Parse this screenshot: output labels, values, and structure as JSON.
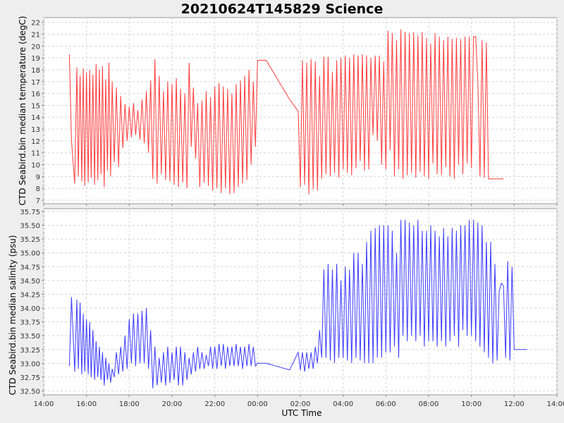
{
  "title": "20210624T145829 Science",
  "colors": {
    "temperature": "#ff3b3b",
    "salinity": "#3b3bff",
    "grid": "#d4d4d4",
    "background": "#ffffff",
    "page": "#eeeeee"
  },
  "chart_data": {
    "type": "line",
    "title": "20210624T145829 Science",
    "xlabel": "UTC Time",
    "x_ticks": [
      "14:00",
      "16:00",
      "18:00",
      "20:00",
      "22:00",
      "00:00",
      "02:00",
      "04:00",
      "06:00",
      "08:00",
      "10:00",
      "12:00",
      "14:00"
    ],
    "xlim": [
      14,
      38
    ],
    "grid": true,
    "panels": [
      {
        "name": "temperature",
        "ylabel": "CTD Seabird.bin median temperature (degC)",
        "ylim": [
          6.7,
          22.4
        ],
        "y_ticks": [
          7,
          8,
          9,
          10,
          11,
          12,
          13,
          14,
          15,
          16,
          17,
          18,
          19,
          20,
          21,
          22
        ],
        "series": [
          {
            "x": [
              15.2,
              15.3,
              15.45,
              15.55,
              15.62,
              15.7,
              15.78,
              15.85,
              15.92,
              16.0,
              16.08,
              16.15,
              16.22,
              16.3,
              16.38,
              16.45,
              16.53,
              16.6,
              16.68,
              16.75,
              16.83,
              16.9,
              16.98,
              17.05,
              17.13,
              17.2,
              17.3,
              17.4,
              17.5,
              17.6,
              17.7,
              17.8,
              17.9,
              18.0,
              18.1,
              18.2,
              18.3,
              18.4,
              18.5,
              18.6,
              18.7,
              18.8,
              18.9,
              19.0,
              19.1,
              19.2,
              19.3,
              19.4,
              19.5,
              19.6,
              19.7,
              19.8,
              19.9,
              20.0,
              20.1,
              20.2,
              20.3,
              20.4,
              20.5,
              20.6,
              20.7,
              20.8,
              20.9,
              21.0,
              21.1,
              21.2,
              21.3,
              21.4,
              21.5,
              21.6,
              21.7,
              21.8,
              21.9,
              22.0,
              22.1,
              22.2,
              22.3,
              22.4,
              22.5,
              22.6,
              22.7,
              22.8,
              22.9,
              23.0,
              23.1,
              23.2,
              23.3,
              23.4,
              23.5,
              23.6,
              23.7,
              23.8,
              23.9,
              24.0,
              24.4,
              25.5,
              25.9,
              26.0,
              26.1,
              26.2,
              26.3,
              26.4,
              26.5,
              26.6,
              26.7,
              26.8,
              26.9,
              27.0,
              27.1,
              27.2,
              27.3,
              27.4,
              27.5,
              27.6,
              27.7,
              27.8,
              27.9,
              28.0,
              28.1,
              28.2,
              28.3,
              28.4,
              28.5,
              28.6,
              28.7,
              28.8,
              28.9,
              29.0,
              29.1,
              29.2,
              29.3,
              29.4,
              29.5,
              29.6,
              29.7,
              29.8,
              29.9,
              30.0,
              30.1,
              30.2,
              30.3,
              30.4,
              30.5,
              30.6,
              30.7,
              30.8,
              30.9,
              31.0,
              31.1,
              31.2,
              31.3,
              31.4,
              31.5,
              31.6,
              31.7,
              31.8,
              31.9,
              32.0,
              32.1,
              32.2,
              32.3,
              32.4,
              32.5,
              32.6,
              32.7,
              32.8,
              32.9,
              33.0,
              33.1,
              33.2,
              33.3,
              33.4,
              33.5,
              33.6,
              33.7,
              33.8,
              33.9,
              34.0,
              34.1,
              34.2,
              34.3,
              34.4,
              34.5,
              34.6,
              34.7,
              34.8,
              34.9,
              35.0,
              35.1,
              35.2,
              35.3,
              35.4,
              35.5,
              35.6,
              35.7,
              35.8,
              35.9,
              36.0,
              36.1,
              36.2,
              36.3,
              36.4,
              36.5,
              36.6,
              36.7,
              36.8,
              36.9,
              37.0
            ],
            "y": [
              19.3,
              12.0,
              8.4,
              18.2,
              9.0,
              17.5,
              8.6,
              18.1,
              8.2,
              17.8,
              8.5,
              18.0,
              8.9,
              17.6,
              8.3,
              18.5,
              8.7,
              18.0,
              9.2,
              18.3,
              8.1,
              17.2,
              9.5,
              18.6,
              9.0,
              17.0,
              10.2,
              16.5,
              9.8,
              15.8,
              11.4,
              15.1,
              12.0,
              14.9,
              12.3,
              15.2,
              12.5,
              14.6,
              12.1,
              15.5,
              11.8,
              16.2,
              11.0,
              17.1,
              8.8,
              18.9,
              8.4,
              17.5,
              9.2,
              16.2,
              8.7,
              17.0,
              8.6,
              16.8,
              8.3,
              17.3,
              8.1,
              16.4,
              8.5,
              16.0,
              8.0,
              18.6,
              11.5,
              16.5,
              10.5,
              15.2,
              8.1,
              15.4,
              8.5,
              16.2,
              8.2,
              15.7,
              7.8,
              16.6,
              8.0,
              16.9,
              7.6,
              16.6,
              8.0,
              16.4,
              7.5,
              16.0,
              7.6,
              16.8,
              8.1,
              17.1,
              8.4,
              17.5,
              8.7,
              18.0,
              10.0,
              17.0,
              11.5,
              18.8,
              18.8,
              15.5,
              14.5,
              8.1,
              18.8,
              8.3,
              18.6,
              7.5,
              18.9,
              7.9,
              18.7,
              7.8,
              17.5,
              8.8,
              19.1,
              9.2,
              19.1,
              9.0,
              17.8,
              9.3,
              18.8,
              8.9,
              19.0,
              9.6,
              19.2,
              9.3,
              19.0,
              9.1,
              19.3,
              9.7,
              19.2,
              10.3,
              19.3,
              9.5,
              19.2,
              9.6,
              19.0,
              12.5,
              19.2,
              12.0,
              19.2,
              10.0,
              18.7,
              9.6,
              21.3,
              11.2,
              21.1,
              9.0,
              20.5,
              9.6,
              21.4,
              8.8,
              21.2,
              9.1,
              21.1,
              9.3,
              21.2,
              8.9,
              20.9,
              9.4,
              21.2,
              9.0,
              20.7,
              8.8,
              20.2,
              10.1,
              21.1,
              9.2,
              20.8,
              9.1,
              20.5,
              9.8,
              20.8,
              9.0,
              20.6,
              8.8,
              20.7,
              10.0,
              20.6,
              9.2,
              20.8,
              10.1,
              20.8,
              9.7,
              20.8,
              20.8,
              17.0,
              9.0,
              20.5,
              8.9,
              20.3,
              8.8,
              8.8,
              8.8,
              8.8,
              8.8,
              8.8,
              8.8,
              8.8
            ]
          }
        ]
      },
      {
        "name": "salinity",
        "ylabel": "CTD Seabird.bin median salinity (psu)",
        "ylim": [
          32.43,
          35.8
        ],
        "y_ticks": [
          "32.50",
          "32.75",
          "33.00",
          "33.25",
          "33.50",
          "33.75",
          "34.00",
          "34.25",
          "34.50",
          "34.75",
          "35.00",
          "35.25",
          "35.50",
          "35.75"
        ],
        "series": [
          {
            "x": [
              15.2,
              15.3,
              15.45,
              15.55,
              15.62,
              15.7,
              15.78,
              15.85,
              15.92,
              16.0,
              16.08,
              16.15,
              16.22,
              16.3,
              16.38,
              16.45,
              16.53,
              16.6,
              16.68,
              16.75,
              16.83,
              16.9,
              16.98,
              17.05,
              17.13,
              17.2,
              17.3,
              17.4,
              17.5,
              17.6,
              17.7,
              17.8,
              17.9,
              18.0,
              18.1,
              18.2,
              18.3,
              18.4,
              18.5,
              18.6,
              18.7,
              18.8,
              18.9,
              19.0,
              19.1,
              19.2,
              19.3,
              19.4,
              19.5,
              19.6,
              19.7,
              19.8,
              19.9,
              20.0,
              20.1,
              20.2,
              20.3,
              20.4,
              20.5,
              20.6,
              20.7,
              20.8,
              20.9,
              21.0,
              21.1,
              21.2,
              21.3,
              21.4,
              21.5,
              21.6,
              21.7,
              21.8,
              21.9,
              22.0,
              22.1,
              22.2,
              22.3,
              22.4,
              22.5,
              22.6,
              22.7,
              22.8,
              22.9,
              23.0,
              23.1,
              23.2,
              23.3,
              23.4,
              23.5,
              23.6,
              23.7,
              23.8,
              23.9,
              24.0,
              24.4,
              25.5,
              25.9,
              26.0,
              26.1,
              26.2,
              26.3,
              26.4,
              26.5,
              26.6,
              26.7,
              26.8,
              26.9,
              27.0,
              27.1,
              27.2,
              27.3,
              27.4,
              27.5,
              27.6,
              27.7,
              27.8,
              27.9,
              28.0,
              28.1,
              28.2,
              28.3,
              28.4,
              28.5,
              28.6,
              28.7,
              28.8,
              28.9,
              29.0,
              29.1,
              29.2,
              29.3,
              29.4,
              29.5,
              29.6,
              29.7,
              29.8,
              29.9,
              30.0,
              30.1,
              30.2,
              30.3,
              30.4,
              30.5,
              30.6,
              30.7,
              30.8,
              30.9,
              31.0,
              31.1,
              31.2,
              31.3,
              31.4,
              31.5,
              31.6,
              31.7,
              31.8,
              31.9,
              32.0,
              32.1,
              32.2,
              32.3,
              32.4,
              32.5,
              32.6,
              32.7,
              32.8,
              32.9,
              33.0,
              33.1,
              33.2,
              33.3,
              33.4,
              33.5,
              33.6,
              33.7,
              33.8,
              33.9,
              34.0,
              34.1,
              34.2,
              34.3,
              34.4,
              34.5,
              34.6,
              34.7,
              34.8,
              34.9,
              35.0,
              35.1,
              35.2,
              35.3,
              35.4,
              35.5,
              35.6,
              35.7,
              35.8,
              35.9,
              36.0,
              36.1,
              36.2,
              36.3,
              36.4,
              36.5,
              36.6,
              36.7,
              36.8,
              36.9,
              37.0
            ],
            "y": [
              32.95,
              34.2,
              32.85,
              34.15,
              32.9,
              34.1,
              32.8,
              33.9,
              32.85,
              33.8,
              32.8,
              33.75,
              32.75,
              33.6,
              32.7,
              33.4,
              32.75,
              33.3,
              32.7,
              33.2,
              32.6,
              33.1,
              32.7,
              33.0,
              32.65,
              32.9,
              32.75,
              33.2,
              32.8,
              33.3,
              32.85,
              33.5,
              32.9,
              33.8,
              33.0,
              33.9,
              32.95,
              33.9,
              33.0,
              33.95,
              33.0,
              34.0,
              32.9,
              33.6,
              32.55,
              33.3,
              32.6,
              33.1,
              32.65,
              33.2,
              32.6,
              33.3,
              32.65,
              33.2,
              32.7,
              33.3,
              32.6,
              33.3,
              32.6,
              33.2,
              32.7,
              33.1,
              32.8,
              33.2,
              32.85,
              33.3,
              32.9,
              33.2,
              32.9,
              33.15,
              32.95,
              33.3,
              32.9,
              33.3,
              32.9,
              33.35,
              32.95,
              33.35,
              32.9,
              33.3,
              32.95,
              33.3,
              32.95,
              33.35,
              32.95,
              33.3,
              32.9,
              33.3,
              32.95,
              33.35,
              32.95,
              33.3,
              32.95,
              33.0,
              33.0,
              32.88,
              33.2,
              32.88,
              33.2,
              32.85,
              33.2,
              32.9,
              33.2,
              32.9,
              33.3,
              33.0,
              33.6,
              33.1,
              34.7,
              33.1,
              34.8,
              33.05,
              34.7,
              33.0,
              34.8,
              33.1,
              34.5,
              33.1,
              34.75,
              33.05,
              34.7,
              33.0,
              35.0,
              33.1,
              35.0,
              33.05,
              34.8,
              33.0,
              35.2,
              33.0,
              35.4,
              33.0,
              35.45,
              33.1,
              35.5,
              33.1,
              35.5,
              33.2,
              35.5,
              33.2,
              35.4,
              33.3,
              35.0,
              33.1,
              35.6,
              33.5,
              35.6,
              33.4,
              35.55,
              33.5,
              35.5,
              33.4,
              35.6,
              33.5,
              35.4,
              33.3,
              35.4,
              33.4,
              35.5,
              33.4,
              35.4,
              33.3,
              35.3,
              33.4,
              35.45,
              33.3,
              35.3,
              33.4,
              35.45,
              33.5,
              35.4,
              33.3,
              35.5,
              33.6,
              35.5,
              33.5,
              35.6,
              33.5,
              35.6,
              33.4,
              35.55,
              33.3,
              35.5,
              33.2,
              35.2,
              33.1,
              35.2,
              33.0,
              34.8,
              33.05,
              34.3,
              34.45,
              34.4,
              33.1,
              34.85,
              33.05,
              34.75,
              33.25,
              33.25,
              33.25,
              33.25,
              33.25,
              33.25,
              33.25
            ]
          }
        ]
      }
    ]
  }
}
